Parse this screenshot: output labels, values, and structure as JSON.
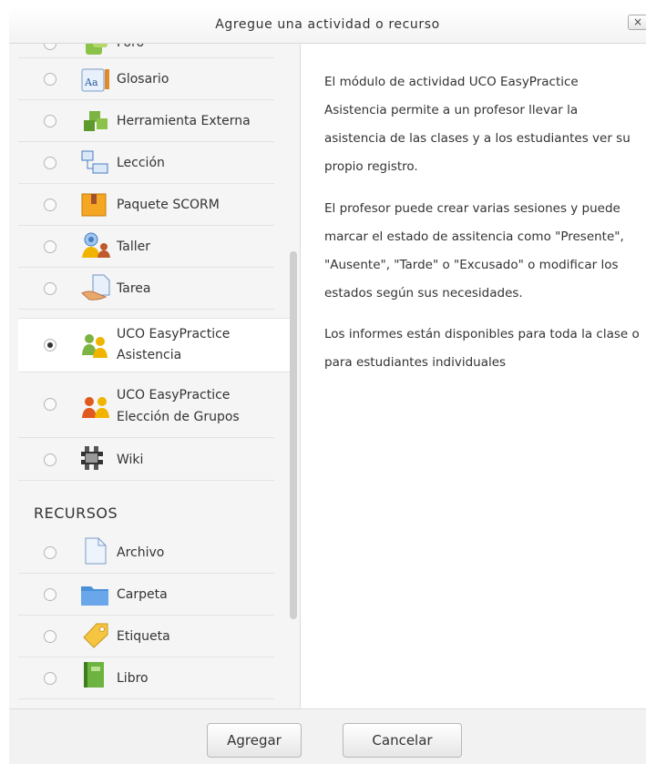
{
  "dialog": {
    "title": "Agregue una actividad o recurso",
    "close_label": "×"
  },
  "activities": [
    {
      "label": "Foro",
      "icon": "forum-icon"
    },
    {
      "label": "Glosario",
      "icon": "glossary-icon"
    },
    {
      "label": "Herramienta Externa",
      "icon": "puzzle-icon"
    },
    {
      "label": "Lección",
      "icon": "lesson-icon"
    },
    {
      "label": "Paquete SCORM",
      "icon": "scorm-icon"
    },
    {
      "label": "Taller",
      "icon": "workshop-icon"
    },
    {
      "label": "Tarea",
      "icon": "assignment-icon"
    },
    {
      "label_line1": "UCO EasyPractice",
      "label_line2": "Asistencia",
      "icon": "attendance-icon",
      "selected": true
    },
    {
      "label_line1": "UCO EasyPractice",
      "label_line2": "Elección de Grupos",
      "icon": "group-choice-icon"
    },
    {
      "label": "Wiki",
      "icon": "wiki-icon"
    }
  ],
  "resources_heading": "RECURSOS",
  "resources": [
    {
      "label": "Archivo",
      "icon": "file-icon"
    },
    {
      "label": "Carpeta",
      "icon": "folder-icon"
    },
    {
      "label": "Etiqueta",
      "icon": "label-tag-icon"
    },
    {
      "label": "Libro",
      "icon": "book-icon"
    }
  ],
  "description": {
    "p1": "El módulo de actividad UCO EasyPractice Asistencia permite a un profesor llevar la asistencia de las clases y a los estudiantes ver su propio registro.",
    "p2": "El profesor puede crear varias sesiones y puede marcar el estado de assitencia como \"Presente\", \"Ausente\", \"Tarde\" o \"Excusado\" o modificar los estados según sus necesidades.",
    "p3": "Los informes están disponibles para toda la clase o para estudiantes individuales"
  },
  "footer": {
    "add_label": "Agregar",
    "cancel_label": "Cancelar"
  }
}
